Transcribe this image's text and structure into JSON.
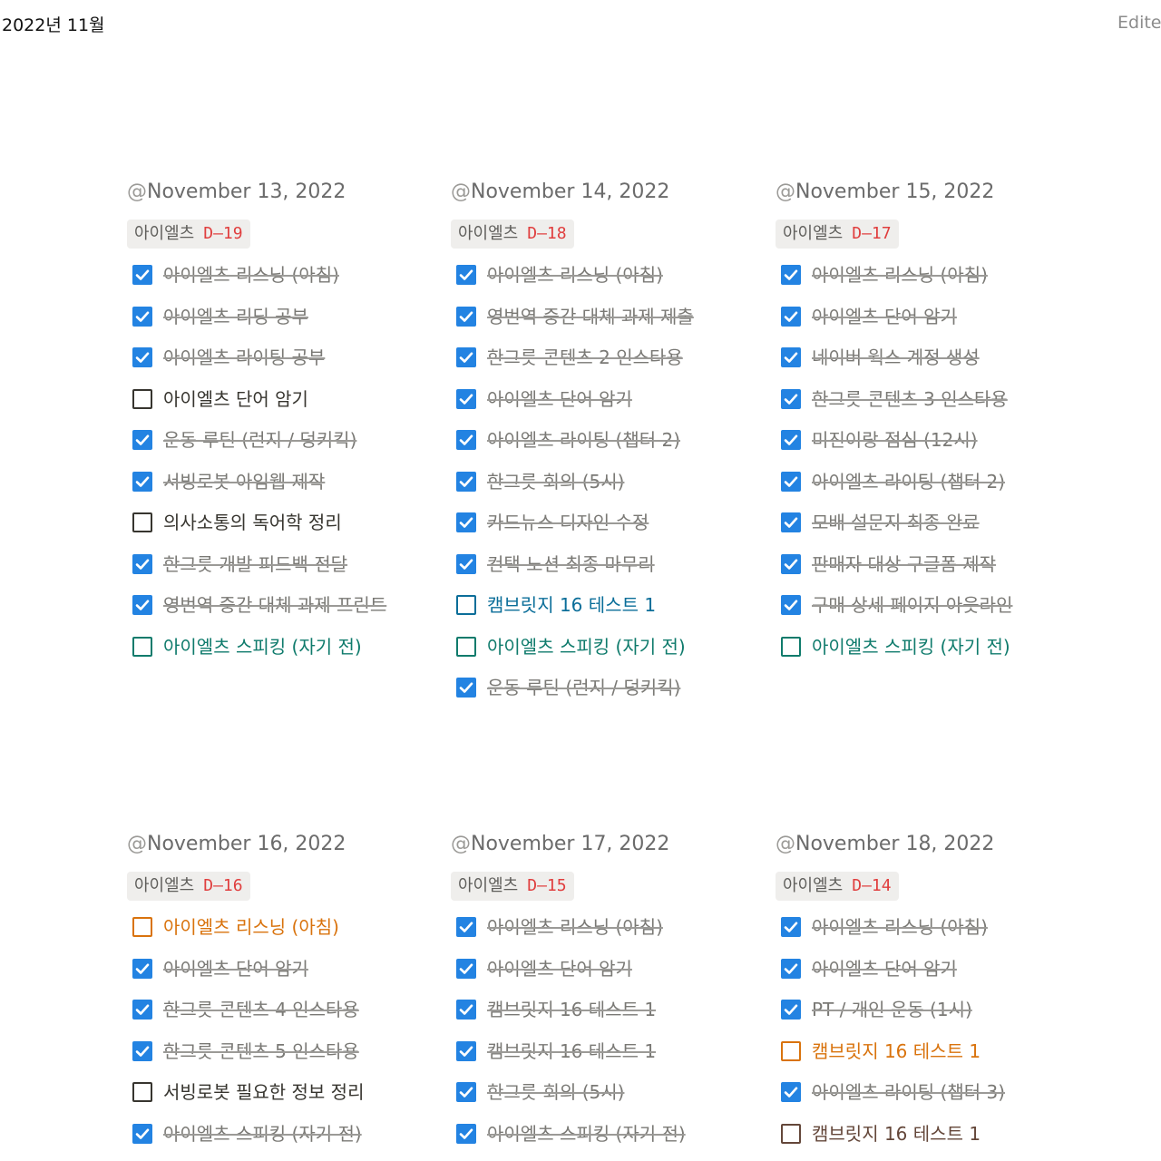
{
  "header": {
    "title": "2022년 11월",
    "edited_label": "Edited"
  },
  "colors": {
    "checkbox_checked": "#2383e2",
    "dday_red": "#e03e3e",
    "blue_text": "#0b6e99",
    "green_text": "#0f7b6c",
    "orange_text": "#d9730d",
    "brown_text": "#64473a"
  },
  "icons": {
    "checked": "checkmark-icon",
    "unchecked": "empty-checkbox-icon"
  },
  "days": [
    {
      "date": "November 13, 2022",
      "tag": {
        "name": "아이엘츠",
        "dday": "D-19"
      },
      "items": [
        {
          "text": "아이엘츠 리스닝 (아침)",
          "checked": true,
          "color": "default"
        },
        {
          "text": "아이엘츠 리딩 공부",
          "checked": true,
          "color": "default"
        },
        {
          "text": "아이엘츠 라이팅 공부",
          "checked": true,
          "color": "default"
        },
        {
          "text": "아이엘츠 단어 암기",
          "checked": false,
          "color": "default"
        },
        {
          "text": "운동 루틴 (런지 / 덩키킥)",
          "checked": true,
          "color": "default"
        },
        {
          "text": "서빙로봇 아임웹 제작",
          "checked": true,
          "color": "default"
        },
        {
          "text": "의사소통의 독어학 정리",
          "checked": false,
          "color": "gray"
        },
        {
          "text": "한그릇 개발 피드백 전달",
          "checked": true,
          "color": "default"
        },
        {
          "text": "영번역 중간 대체 과제 프린트",
          "checked": true,
          "color": "default"
        },
        {
          "text": "아이엘츠 스피킹 (자기 전)",
          "checked": false,
          "color": "green"
        }
      ]
    },
    {
      "date": "November 14, 2022",
      "tag": {
        "name": "아이엘츠",
        "dday": "D-18"
      },
      "items": [
        {
          "text": "아이엘츠 리스닝 (아침)",
          "checked": true,
          "color": "default"
        },
        {
          "text": "영번역 중간 대체 과제 제출",
          "checked": true,
          "color": "default"
        },
        {
          "text": "한그릇 콘텐츠 2 인스타용",
          "checked": true,
          "color": "default"
        },
        {
          "text": "아이엘츠 단어 암기",
          "checked": true,
          "color": "default"
        },
        {
          "text": "아이엘츠 라이팅 (챕터 2)",
          "checked": true,
          "color": "default"
        },
        {
          "text": "한그릇 회의 (5시)",
          "checked": true,
          "color": "default"
        },
        {
          "text": "카드뉴스 디자인 수정",
          "checked": true,
          "color": "default"
        },
        {
          "text": "컨택 노션 최종 마무리",
          "checked": true,
          "color": "default"
        },
        {
          "text": "캠브릿지 16 테스트 1",
          "checked": false,
          "color": "blue"
        },
        {
          "text": "아이엘츠 스피킹 (자기 전)",
          "checked": false,
          "color": "green"
        },
        {
          "text": "운동 루틴 (런지 / 덩키킥)",
          "checked": true,
          "color": "default"
        }
      ]
    },
    {
      "date": "November 15, 2022",
      "tag": {
        "name": "아이엘츠",
        "dday": "D-17"
      },
      "items": [
        {
          "text": "아이엘츠 리스닝 (아침)",
          "checked": true,
          "color": "default"
        },
        {
          "text": "아이엘츠 단어 암기",
          "checked": true,
          "color": "default"
        },
        {
          "text": "네이버 웍스 계정 생성",
          "checked": true,
          "color": "default"
        },
        {
          "text": "한그릇 콘텐츠 3 인스타용",
          "checked": true,
          "color": "default"
        },
        {
          "text": "미진이랑 점심 (12시)",
          "checked": true,
          "color": "default"
        },
        {
          "text": "아이엘츠 라이팅 (챕터 2)",
          "checked": true,
          "color": "default"
        },
        {
          "text": "모배 설문지 최종 완료",
          "checked": true,
          "color": "default"
        },
        {
          "text": "판매자 대상 구글폼 제작",
          "checked": true,
          "color": "default"
        },
        {
          "text": "구매 상세 페이지 아웃라인",
          "checked": true,
          "color": "default"
        },
        {
          "text": "아이엘츠 스피킹 (자기 전)",
          "checked": false,
          "color": "green"
        }
      ]
    },
    {
      "date": "November 16, 2022",
      "tag": {
        "name": "아이엘츠",
        "dday": "D-16"
      },
      "items": [
        {
          "text": "아이엘츠 리스닝 (아침)",
          "checked": false,
          "color": "orange"
        },
        {
          "text": "아이엘츠 단어 암기",
          "checked": true,
          "color": "default"
        },
        {
          "text": "한그릇 콘텐츠 4 인스타용",
          "checked": true,
          "color": "default"
        },
        {
          "text": "한그릇 콘텐츠 5 인스타용",
          "checked": true,
          "color": "default"
        },
        {
          "text": "서빙로봇 필요한 정보 정리",
          "checked": false,
          "color": "default"
        },
        {
          "text": "아이엘츠 스피킹 (자기 전)",
          "checked": true,
          "color": "default"
        }
      ]
    },
    {
      "date": "November 17, 2022",
      "tag": {
        "name": "아이엘츠",
        "dday": "D-15"
      },
      "items": [
        {
          "text": "아이엘츠 리스닝 (아침)",
          "checked": true,
          "color": "default"
        },
        {
          "text": "아이엘츠 단어 암기",
          "checked": true,
          "color": "default"
        },
        {
          "text": "캠브릿지 16 테스트 1",
          "checked": true,
          "color": "default"
        },
        {
          "text": "캠브릿지 16 테스트 1",
          "checked": true,
          "color": "default"
        },
        {
          "text": "한그릇 회의 (5시)",
          "checked": true,
          "color": "default"
        },
        {
          "text": "아이엘츠 스피킹 (자기 전)",
          "checked": true,
          "color": "default"
        }
      ]
    },
    {
      "date": "November 18, 2022",
      "tag": {
        "name": "아이엘츠",
        "dday": "D-14"
      },
      "items": [
        {
          "text": "아이엘츠 리스닝 (아침)",
          "checked": true,
          "color": "default"
        },
        {
          "text": "아이엘츠 단어 암기",
          "checked": true,
          "color": "default"
        },
        {
          "text": "PT / 개인 운동 (1시)",
          "checked": true,
          "color": "default"
        },
        {
          "text": "캠브릿지 16 테스트 1",
          "checked": false,
          "color": "orange"
        },
        {
          "text": "아이엘츠 라이팅 (챕터 3)",
          "checked": true,
          "color": "default"
        },
        {
          "text": "캠브릿지 16 테스트 1",
          "checked": false,
          "color": "brown"
        }
      ]
    }
  ]
}
